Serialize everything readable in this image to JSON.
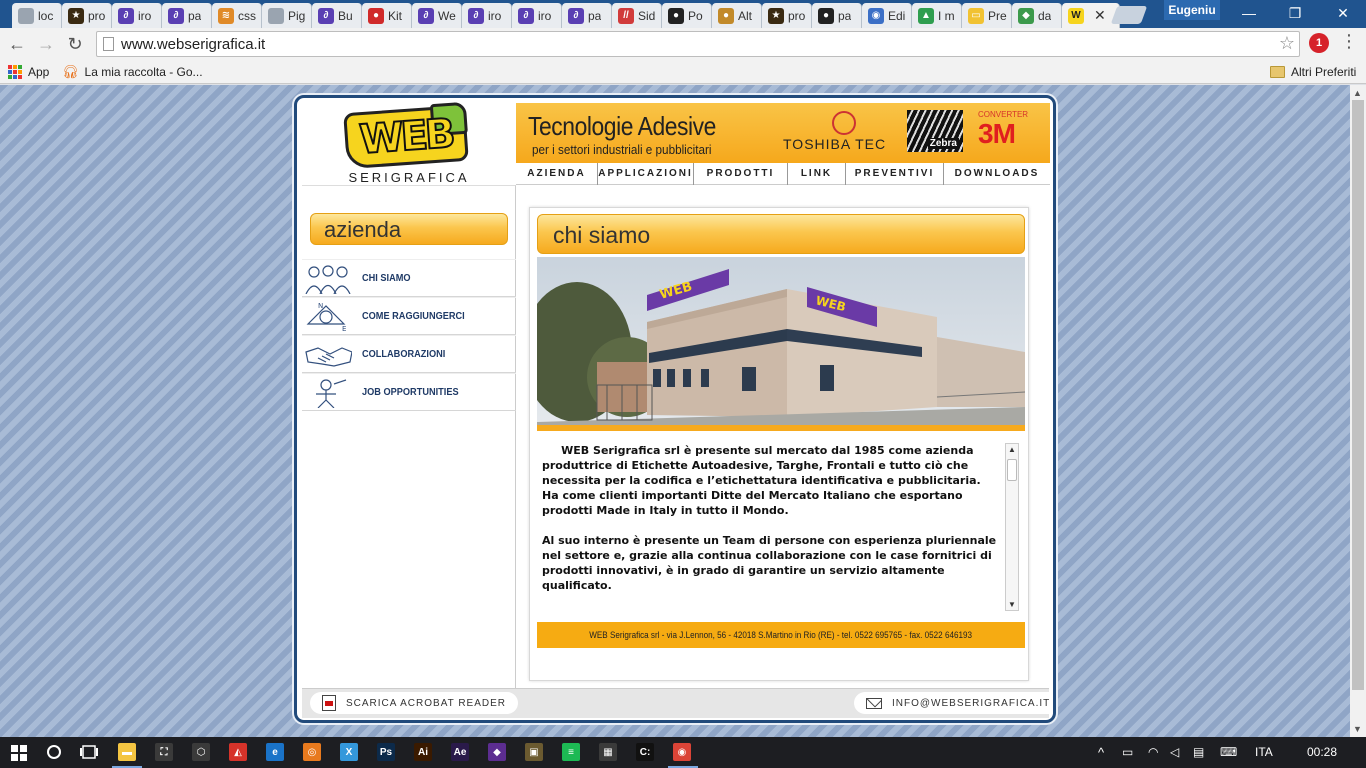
{
  "browser": {
    "tabs": [
      {
        "label": "loc",
        "fav_color": "#9aa4b0",
        "fav_glyph": ""
      },
      {
        "label": "pro",
        "fav_color": "#3a2a12",
        "fav_glyph": "★"
      },
      {
        "label": "iro",
        "fav_color": "#5a3fb3",
        "fav_glyph": "∂"
      },
      {
        "label": "pa",
        "fav_color": "#5a3fb3",
        "fav_glyph": "∂"
      },
      {
        "label": "css",
        "fav_color": "#e08a28",
        "fav_glyph": "≋"
      },
      {
        "label": "Pig",
        "fav_color": "#9aa4b0",
        "fav_glyph": ""
      },
      {
        "label": "Bu",
        "fav_color": "#5a3fb3",
        "fav_glyph": "∂"
      },
      {
        "label": "Kit",
        "fav_color": "#d02a2a",
        "fav_glyph": "●"
      },
      {
        "label": "We",
        "fav_color": "#5a3fb3",
        "fav_glyph": "∂"
      },
      {
        "label": "iro",
        "fav_color": "#5a3fb3",
        "fav_glyph": "∂"
      },
      {
        "label": "iro",
        "fav_color": "#5a3fb3",
        "fav_glyph": "∂"
      },
      {
        "label": "pa",
        "fav_color": "#5a3fb3",
        "fav_glyph": "∂"
      },
      {
        "label": "Sid",
        "fav_color": "#d13b3b",
        "fav_glyph": "//"
      },
      {
        "label": "Po",
        "fav_color": "#222222",
        "fav_glyph": "●"
      },
      {
        "label": "Alt",
        "fav_color": "#c28a2a",
        "fav_glyph": "●"
      },
      {
        "label": "pro",
        "fav_color": "#3a2a12",
        "fav_glyph": "★"
      },
      {
        "label": "pa",
        "fav_color": "#222222",
        "fav_glyph": "●"
      },
      {
        "label": "Edi",
        "fav_color": "#3b6fc6",
        "fav_glyph": "◉"
      },
      {
        "label": "I m",
        "fav_color": "#2f9e4f",
        "fav_glyph": "▲"
      },
      {
        "label": "Pre",
        "fav_color": "#f1c232",
        "fav_glyph": "▭"
      },
      {
        "label": "da",
        "fav_color": "#3c9a4c",
        "fav_glyph": "◆"
      },
      {
        "label": "",
        "fav_color": "#f6d41e",
        "fav_glyph": "W",
        "active": true
      }
    ],
    "close_glyph": "✕",
    "profile_name": "Eugeniu",
    "window_buttons": {
      "minimize": "—",
      "maximize": "❐",
      "close": "✕"
    },
    "nav": {
      "back": "←",
      "forward": "→",
      "reload": "↻"
    },
    "url": "www.webserigrafica.it",
    "star_glyph": "☆",
    "ext_badge": "1",
    "menu_glyph": "⋮",
    "bookmarks": {
      "apps": "App",
      "raccolta": "La mia raccolta - Go...",
      "altri": "Altri Preferiti"
    },
    "colors": {
      "tabstrip": "#20548f",
      "toolbar": "#f2f2f2"
    }
  },
  "site": {
    "logo_text": "WEB",
    "logo_sub": "SERIGRAFICA",
    "banner": {
      "title": "Tecnologie Adesive",
      "subtitle": "per i settori industriali e pubblicitari",
      "toshiba": "TOSHIBA TEC",
      "zebra": "Zebra",
      "converter": "CONVERTER",
      "mmm": "3M"
    },
    "top_nav": [
      {
        "label": "AZIENDA",
        "w": 82
      },
      {
        "label": "APPLICAZIONI",
        "w": 96
      },
      {
        "label": "PRODOTTI",
        "w": 94
      },
      {
        "label": "LINK",
        "w": 58
      },
      {
        "label": "PREVENTIVI",
        "w": 98
      },
      {
        "label": "DOWNLOADS",
        "w": 106
      }
    ],
    "side_title": "azienda",
    "side_items": [
      {
        "label": "CHI SIAMO",
        "icon": "people-icon"
      },
      {
        "label": "COME RAGGIUNGERCI",
        "icon": "compass-icon"
      },
      {
        "label": "COLLABORAZIONI",
        "icon": "handshake-icon"
      },
      {
        "label": "JOB OPPORTUNITIES",
        "icon": "worker-icon"
      }
    ],
    "main_title": "chi siamo",
    "paragraphs": [
      "     WEB Serigrafica srl è presente sul mercato dal 1985 come azienda produttrice di Etichette Autoadesive, Targhe, Frontali e tutto ciò che necessita per la codifica e l’etichettatura identificativa e pubblicitaria. Ha come clienti importanti Ditte del Mercato Italiano che esportano prodotti Made in Italy in tutto il Mondo.",
      "Al suo interno è presente un Team di persone con esperienza pluriennale nel settore e, grazie alla continua collaborazione con le case fornitrici di prodotti innovativi, è in grado di garantire un servizio altamente qualificato."
    ],
    "address": "WEB Serigrafica srl - via J.Lennon, 56 - 42018 S.Martino in Rio (RE) - tel. 0522 695765 - fax. 0522 646193",
    "acrobat": "SCARICA ACROBAT READER",
    "email": "INFO@WEBSERIGRAFICA.IT",
    "colors": {
      "accent": "#f6aa1e",
      "frame": "#214a7b",
      "nav_text": "#1f3a66"
    }
  },
  "taskbar": {
    "language": "ITA",
    "time": "00:28",
    "apps": [
      {
        "name": "file-explorer-icon",
        "color": "#f4c542",
        "glyph": "▬"
      },
      {
        "name": "store-icon",
        "color": "#3a3a3a",
        "glyph": "⛶"
      },
      {
        "name": "cube-icon",
        "color": "#3a3a3a",
        "glyph": "⬡"
      },
      {
        "name": "sketchup-icon",
        "color": "#d6332a",
        "glyph": "◭"
      },
      {
        "name": "edge-icon",
        "color": "#1a73c8",
        "glyph": "e"
      },
      {
        "name": "blender-icon",
        "color": "#e87a1e",
        "glyph": "◎"
      },
      {
        "name": "xamarin-icon",
        "color": "#3498db",
        "glyph": "X"
      },
      {
        "name": "photoshop-icon",
        "color": "#0c2a4a",
        "glyph": "Ps"
      },
      {
        "name": "illustrator-icon",
        "color": "#3a1a00",
        "glyph": "Ai"
      },
      {
        "name": "after-effects-icon",
        "color": "#2a1a4a",
        "glyph": "Ae"
      },
      {
        "name": "visual-studio-icon",
        "color": "#5c2d91",
        "glyph": "◆"
      },
      {
        "name": "image-viewer-icon",
        "color": "#6b5a30",
        "glyph": "▣"
      },
      {
        "name": "spotify-icon",
        "color": "#1db954",
        "glyph": "≡"
      },
      {
        "name": "calculator-icon",
        "color": "#3a3a3a",
        "glyph": "▦"
      },
      {
        "name": "terminal-icon",
        "color": "#111111",
        "glyph": "C:"
      },
      {
        "name": "chrome-icon",
        "color": "#db4437",
        "glyph": "◉"
      }
    ]
  }
}
